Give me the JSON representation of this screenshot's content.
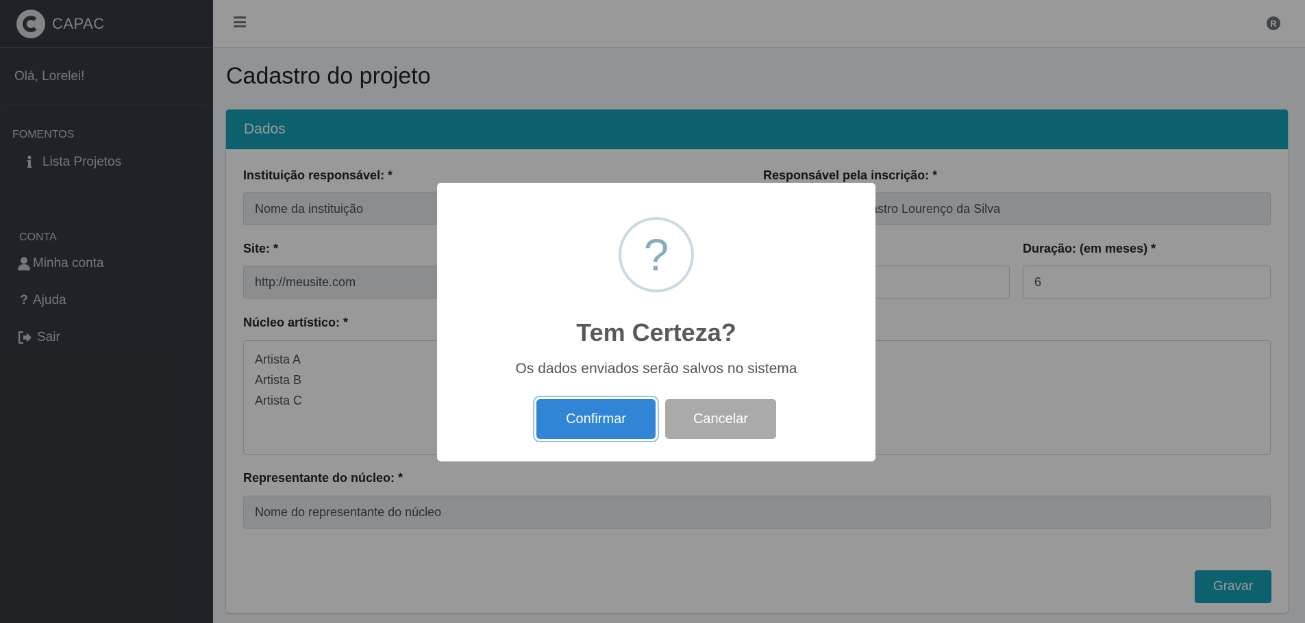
{
  "brand": {
    "name": "CAPAC"
  },
  "user": {
    "greeting": "Olá, Lorelei!"
  },
  "sidebar": {
    "sections": [
      {
        "header": "FOMENTOS",
        "items": [
          {
            "label": "Lista Projetos",
            "icon": "info-icon"
          }
        ]
      },
      {
        "header": "CONTA",
        "items": [
          {
            "label": "Minha conta",
            "icon": "user-icon"
          },
          {
            "label": "Ajuda",
            "icon": "question-icon"
          },
          {
            "label": "Sair",
            "icon": "sign-out-icon"
          }
        ]
      }
    ]
  },
  "topbar": {
    "avatar_letter": "R"
  },
  "page": {
    "title": "Cadastro do projeto"
  },
  "card": {
    "header": "Dados",
    "fields": {
      "instituicao": {
        "label": "Instituição responsável: *",
        "value": "Nome da instituição"
      },
      "responsavel": {
        "label": "Responsável pela inscrição: *",
        "value": "astro Lourenço da Silva"
      },
      "site": {
        "label": "Site: *",
        "value": "http://meusite.com"
      },
      "duracao": {
        "label": "Duração: (em meses) *",
        "value": "6"
      },
      "nucleo": {
        "label": "Núcleo artístico: *",
        "lines": [
          "Artista A",
          "Artista B",
          "Artista C"
        ]
      },
      "representante": {
        "label": "Representante do núcleo: *",
        "value": "Nome do representante do núcleo"
      }
    },
    "save_label": "Gravar"
  },
  "modal": {
    "icon": "?",
    "title": "Tem Certeza?",
    "text": "Os dados enviados serão salvos no sistema",
    "confirm_label": "Confirmar",
    "cancel_label": "Cancelar"
  },
  "colors": {
    "accent": "#17a2b8",
    "confirm": "#3085d6",
    "sidebar": "#343a40"
  }
}
